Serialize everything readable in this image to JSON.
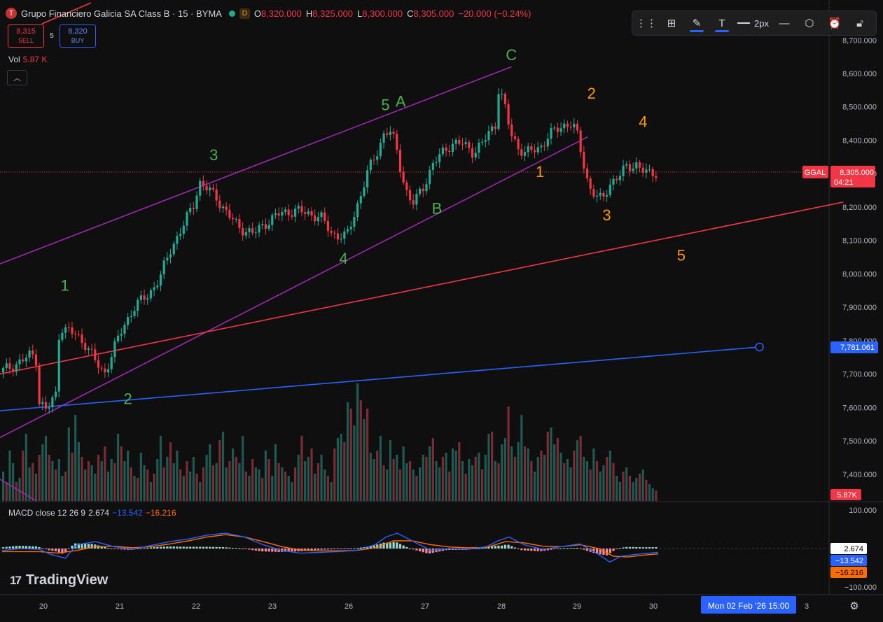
{
  "header": {
    "symbol_icon": "T",
    "title": "Grupo Financiero Galicia SA Class B · 15 · BYMA",
    "badge": "D",
    "o_label": "O",
    "o_value": "8,320.000",
    "h_label": "H",
    "h_value": "8,325.000",
    "l_label": "L",
    "l_value": "8,300.000",
    "c_label": "C",
    "c_value": "8,305.000",
    "change": "−20.000 (−0.24%)"
  },
  "trade": {
    "sell_price": "8,315",
    "sell_label": "SELL",
    "spread": "5",
    "buy_price": "8,320",
    "buy_label": "BUY"
  },
  "volume_legend": {
    "label": "Vol",
    "value": "5.87 K"
  },
  "toolbar": {
    "width_label": "2px",
    "icons": [
      "drag-handle-icon",
      "template-icon",
      "pencil-icon",
      "text-icon",
      "line-width-icon",
      "line-style-icon",
      "visibility-icon",
      "alert-icon",
      "lock-icon",
      "more-icon"
    ]
  },
  "macd_legend": {
    "label": "MACD close 12 26 9",
    "macd": "2.674",
    "signal": "−13.542",
    "hist": "−16.216"
  },
  "logo_text": "TradingView",
  "colors": {
    "up": "#22ab94",
    "down": "#f23645",
    "channel": "#9c27b0",
    "red_line": "#f23645",
    "blue_line": "#2962ff",
    "green_label": "#4caf50",
    "orange_label": "#ff9800"
  },
  "chart_data": {
    "type": "candlestick",
    "symbol": "GGAL",
    "interval": "15",
    "exchange": "BYMA",
    "price_axis": {
      "ticks": [
        "8,700.000",
        "8,600.000",
        "8,500.000",
        "8,400.000",
        "8,300.000",
        "8,200.000",
        "8,100.000",
        "8,000.000",
        "7,900.000",
        "7,800.000",
        "7,700.000",
        "7,600.000",
        "7,500.000",
        "7,400.000"
      ],
      "range": [
        7320,
        8820
      ]
    },
    "time_axis": {
      "ticks": [
        "20",
        "21",
        "22",
        "23",
        "26",
        "27",
        "28",
        "29",
        "30",
        "3"
      ],
      "crosshair_label": "Mon 02 Feb '26   15:00"
    },
    "last_price": {
      "symbol": "GGAL",
      "value": "8,305.000",
      "countdown": "04:21",
      "value_num": 8305
    },
    "drawn_line_label": "7,781.061",
    "volume_label": "5.87K",
    "macd_axis": {
      "ticks": [
        "100.000",
        "−100.000"
      ],
      "labels": {
        "macd": "2.674",
        "signal": "−13.542",
        "hist": "−16.216"
      }
    },
    "price_path": [
      [
        0,
        7705
      ],
      [
        0.6,
        7740
      ],
      [
        0.85,
        7760
      ],
      [
        1.0,
        7740
      ],
      [
        1.05,
        7620
      ],
      [
        1.25,
        7590
      ],
      [
        1.5,
        7640
      ],
      [
        1.6,
        7850
      ],
      [
        1.7,
        7835
      ],
      [
        2.0,
        7820
      ],
      [
        2.3,
        7790
      ],
      [
        2.6,
        7730
      ],
      [
        2.8,
        7700
      ],
      [
        3.0,
        7760
      ],
      [
        3.3,
        7840
      ],
      [
        3.6,
        7900
      ],
      [
        4.0,
        7940
      ],
      [
        4.3,
        7990
      ],
      [
        4.6,
        8080
      ],
      [
        4.9,
        8140
      ],
      [
        5.2,
        8210
      ],
      [
        5.35,
        8275
      ],
      [
        5.5,
        8260
      ],
      [
        5.8,
        8230
      ],
      [
        6.1,
        8180
      ],
      [
        6.4,
        8140
      ],
      [
        6.8,
        8120
      ],
      [
        7.1,
        8150
      ],
      [
        7.5,
        8180
      ],
      [
        7.9,
        8190
      ],
      [
        8.3,
        8180
      ],
      [
        8.6,
        8170
      ],
      [
        8.9,
        8120
      ],
      [
        9.3,
        8110
      ],
      [
        9.6,
        8210
      ],
      [
        9.85,
        8300
      ],
      [
        10.1,
        8360
      ],
      [
        10.3,
        8420
      ],
      [
        10.45,
        8430
      ],
      [
        10.6,
        8390
      ],
      [
        10.8,
        8290
      ],
      [
        10.95,
        8230
      ],
      [
        11.1,
        8210
      ],
      [
        11.35,
        8260
      ],
      [
        11.6,
        8325
      ],
      [
        11.85,
        8360
      ],
      [
        12.1,
        8390
      ],
      [
        12.4,
        8390
      ],
      [
        12.7,
        8365
      ],
      [
        12.95,
        8390
      ],
      [
        13.1,
        8420
      ],
      [
        13.3,
        8450
      ],
      [
        13.35,
        8560
      ],
      [
        13.5,
        8520
      ],
      [
        13.7,
        8420
      ],
      [
        13.9,
        8380
      ],
      [
        14.1,
        8360
      ],
      [
        14.3,
        8370
      ],
      [
        14.5,
        8380
      ],
      [
        14.7,
        8410
      ],
      [
        14.9,
        8430
      ],
      [
        15.1,
        8445
      ],
      [
        15.3,
        8450
      ],
      [
        15.45,
        8430
      ],
      [
        15.6,
        8360
      ],
      [
        15.8,
        8260
      ],
      [
        16.0,
        8230
      ],
      [
        16.15,
        8220
      ],
      [
        16.35,
        8270
      ],
      [
        16.6,
        8290
      ],
      [
        16.8,
        8320
      ],
      [
        17.05,
        8330
      ],
      [
        17.2,
        8310
      ],
      [
        17.4,
        8300
      ],
      [
        17.6,
        8305
      ]
    ],
    "volume": [
      14,
      9,
      24,
      18,
      9,
      11,
      24,
      32,
      16,
      18,
      13,
      22,
      27,
      31,
      22,
      19,
      15,
      20,
      12,
      14,
      35,
      23,
      41,
      28,
      21,
      15,
      19,
      17,
      13,
      22,
      19,
      26,
      14,
      20,
      18,
      32,
      26,
      19,
      24,
      16,
      12,
      11,
      23,
      17,
      15,
      9,
      13,
      20,
      31,
      16,
      21,
      28,
      18,
      24,
      15,
      12,
      19,
      14,
      21,
      13,
      9,
      16,
      22,
      27,
      17,
      18,
      29,
      33,
      16,
      19,
      25,
      21,
      18,
      31,
      14,
      12,
      20,
      16,
      15,
      11,
      24,
      20,
      12,
      27,
      18,
      16,
      14,
      12,
      9,
      16,
      22,
      31,
      19,
      21,
      25,
      13,
      18,
      22,
      15,
      12,
      9,
      25,
      30,
      32,
      28,
      47,
      44,
      36,
      56,
      48,
      39,
      44,
      23,
      20,
      24,
      31,
      17,
      15,
      29,
      20,
      22,
      15,
      26,
      18,
      19,
      15,
      12,
      16,
      22,
      21,
      26,
      30,
      19,
      16,
      21,
      23,
      14,
      25,
      24,
      28,
      19,
      13,
      20,
      17,
      21,
      23,
      15,
      22,
      32,
      33,
      19,
      18,
      27,
      30,
      45,
      26,
      21,
      28,
      41,
      26,
      25,
      19,
      14,
      21,
      24,
      22,
      33,
      35,
      27,
      30,
      23,
      18,
      20,
      16,
      24,
      29,
      31,
      21,
      19,
      15,
      25,
      19,
      14,
      17,
      21,
      24,
      18,
      12,
      9,
      14,
      16,
      12,
      9,
      11,
      13,
      15,
      10,
      8,
      6,
      5
    ],
    "macd_path": [
      [
        0,
        -5
      ],
      [
        0.5,
        0
      ],
      [
        1.0,
        -2
      ],
      [
        1.3,
        -15
      ],
      [
        1.7,
        -25
      ],
      [
        2.0,
        10
      ],
      [
        2.5,
        18
      ],
      [
        3.0,
        5
      ],
      [
        3.5,
        -2
      ],
      [
        4.0,
        8
      ],
      [
        4.5,
        18
      ],
      [
        5.0,
        25
      ],
      [
        5.5,
        35
      ],
      [
        6.0,
        40
      ],
      [
        6.5,
        30
      ],
      [
        7.0,
        10
      ],
      [
        7.5,
        -5
      ],
      [
        8.0,
        -12
      ],
      [
        8.5,
        -10
      ],
      [
        9.0,
        -8
      ],
      [
        9.5,
        -5
      ],
      [
        10.0,
        10
      ],
      [
        10.3,
        30
      ],
      [
        10.6,
        40
      ],
      [
        11.0,
        20
      ],
      [
        11.5,
        -5
      ],
      [
        12.0,
        0
      ],
      [
        12.5,
        -2
      ],
      [
        13.0,
        5
      ],
      [
        13.3,
        20
      ],
      [
        13.6,
        30
      ],
      [
        14.0,
        10
      ],
      [
        14.5,
        -2
      ],
      [
        15.0,
        5
      ],
      [
        15.5,
        12
      ],
      [
        16.0,
        -15
      ],
      [
        16.3,
        -35
      ],
      [
        16.6,
        -20
      ],
      [
        17.0,
        -15
      ],
      [
        17.6,
        -10
      ]
    ],
    "signal_path": [
      [
        0,
        -8
      ],
      [
        1.0,
        -8
      ],
      [
        1.5,
        -12
      ],
      [
        2.0,
        -5
      ],
      [
        2.5,
        5
      ],
      [
        3.0,
        6
      ],
      [
        3.5,
        2
      ],
      [
        4.0,
        5
      ],
      [
        4.5,
        12
      ],
      [
        5.0,
        20
      ],
      [
        5.5,
        30
      ],
      [
        6.0,
        36
      ],
      [
        6.5,
        30
      ],
      [
        7.0,
        18
      ],
      [
        7.5,
        5
      ],
      [
        8.0,
        -4
      ],
      [
        8.5,
        -6
      ],
      [
        9.0,
        -6
      ],
      [
        9.5,
        -5
      ],
      [
        10.0,
        2
      ],
      [
        10.5,
        20
      ],
      [
        11.0,
        20
      ],
      [
        11.5,
        10
      ],
      [
        12.0,
        4
      ],
      [
        12.5,
        2
      ],
      [
        13.0,
        3
      ],
      [
        13.5,
        18
      ],
      [
        14.0,
        15
      ],
      [
        14.5,
        6
      ],
      [
        15.0,
        5
      ],
      [
        15.5,
        10
      ],
      [
        16.0,
        0
      ],
      [
        16.4,
        -20
      ],
      [
        16.8,
        -22
      ],
      [
        17.2,
        -17
      ],
      [
        17.6,
        -14
      ]
    ],
    "wave_labels": [
      {
        "text": "1",
        "x": 1.7,
        "price": 7950,
        "color": "green"
      },
      {
        "text": "2",
        "x": 3.35,
        "price": 7610,
        "color": "green"
      },
      {
        "text": "3",
        "x": 5.6,
        "price": 8340,
        "color": "green"
      },
      {
        "text": "4",
        "x": 9.0,
        "price": 8030,
        "color": "green"
      },
      {
        "text": "5",
        "x": 10.1,
        "price": 8490,
        "color": "green"
      },
      {
        "text": "A",
        "x": 10.5,
        "price": 8500,
        "color": "green"
      },
      {
        "text": "B",
        "x": 11.45,
        "price": 8180,
        "color": "green"
      },
      {
        "text": "C",
        "x": 13.4,
        "price": 8640,
        "color": "green"
      },
      {
        "text": "1",
        "x": 14.15,
        "price": 8290,
        "color": "orange"
      },
      {
        "text": "2",
        "x": 15.5,
        "price": 8525,
        "color": "orange"
      },
      {
        "text": "3",
        "x": 15.9,
        "price": 8160,
        "color": "orange"
      },
      {
        "text": "4",
        "x": 16.85,
        "price": 8440,
        "color": "orange"
      },
      {
        "text": "5",
        "x": 17.85,
        "price": 8040,
        "color": "orange"
      }
    ],
    "lines": {
      "channel_upper": [
        [
          0,
          8030
        ],
        [
          13.4,
          8620
        ]
      ],
      "channel_lower": [
        [
          0,
          7510
        ],
        [
          15.4,
          8410
        ]
      ],
      "red_trend": [
        [
          0,
          7700
        ],
        [
          22.1,
          8215
        ]
      ],
      "blue_line": [
        [
          0,
          7590
        ],
        [
          19.9,
          7781
        ]
      ]
    }
  }
}
